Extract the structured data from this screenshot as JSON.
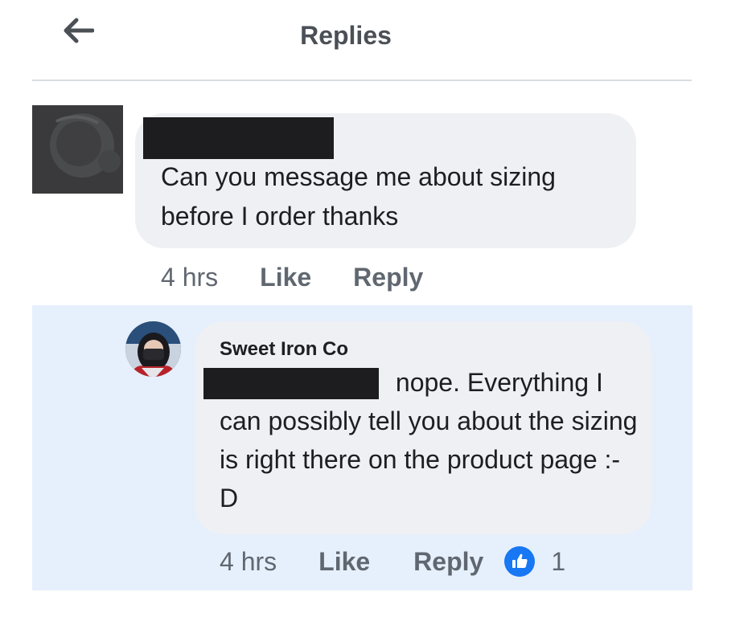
{
  "header": {
    "title": "Replies",
    "back_icon": "arrow-left-icon"
  },
  "comment": {
    "text": "Can you message me about sizing before I order thanks",
    "time": "4 hrs",
    "like_label": "Like",
    "reply_label": "Reply"
  },
  "reply": {
    "author": "Sweet Iron Co",
    "text_line1": "nope. Everything I",
    "text_rest": "can possibly tell you about the sizing is right there on the product page :-D",
    "time": "4 hrs",
    "like_label": "Like",
    "reply_label": "Reply",
    "reaction_icon": "thumbs-up-icon",
    "reaction_count": "1"
  },
  "colors": {
    "reply_highlight": "#e6f0fc",
    "bubble": "#eff0f3",
    "reaction_blue": "#1877f2",
    "meta_gray": "#606770"
  }
}
